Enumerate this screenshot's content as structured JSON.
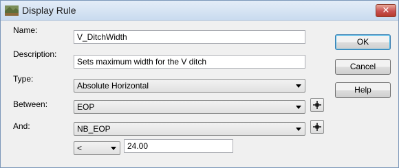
{
  "window": {
    "title": "Display Rule",
    "close_glyph": "✕",
    "title_icon": "display-rule-icon"
  },
  "form": {
    "name_label": "Name:",
    "name_value": "V_DitchWidth",
    "description_label": "Description:",
    "description_value": "Sets maximum width for the V ditch",
    "type_label": "Type:",
    "type_value": "Absolute Horizontal",
    "between_label": "Between:",
    "between_value": "EOP",
    "and_label": "And:",
    "and_value": "NB_EOP",
    "operator_value": "<",
    "distance_value": "24.00"
  },
  "buttons": {
    "ok": "OK",
    "cancel": "Cancel",
    "help": "Help"
  },
  "colors": {
    "close_button": "#c75050",
    "title_bar": "#dbe6f4",
    "default_button_border": "#3c7fb1"
  }
}
